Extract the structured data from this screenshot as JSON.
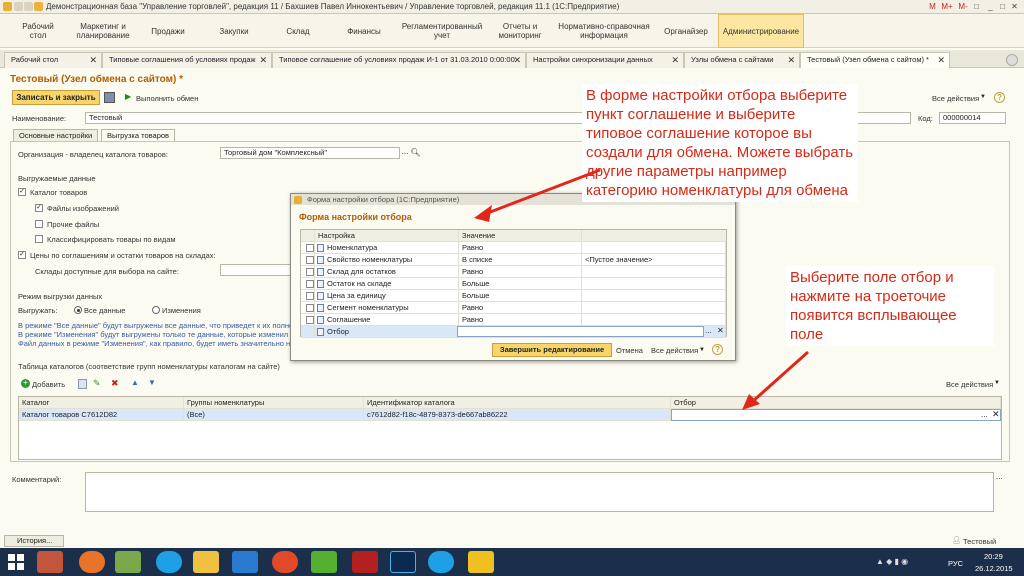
{
  "window": {
    "title": "Демонстрационная база \"Управление торговлей\", редакция 11 / Бахшиев Павел Иннокентьевич / Управление торговлей, редакция 11.1  (1С:Предприятие)",
    "controls": [
      "M",
      "M+",
      "M-",
      "□",
      "_",
      "□",
      "✕"
    ]
  },
  "menu": {
    "items": [
      {
        "label": "Рабочий\nстол"
      },
      {
        "label": "Маркетинг и\nпланирование"
      },
      {
        "label": "Продажи"
      },
      {
        "label": "Закупки"
      },
      {
        "label": "Склад"
      },
      {
        "label": "Финансы"
      },
      {
        "label": "Регламентированный\nучет"
      },
      {
        "label": "Отчеты и\nмониторинг"
      },
      {
        "label": "Нормативно-справочная\nинформация"
      },
      {
        "label": "Органайзер"
      },
      {
        "label": "Администрирование"
      }
    ]
  },
  "tabs": [
    {
      "label": "Рабочий стол"
    },
    {
      "label": "Типовые соглашения об условиях продаж"
    },
    {
      "label": "Типовое соглашение об условиях продаж И-1 от 31.03.2010 0:00:00"
    },
    {
      "label": "Настройки синхронизации данных"
    },
    {
      "label": "Узлы обмена с сайтами"
    },
    {
      "label": "Тестовый (Узел обмена с сайтом) *"
    }
  ],
  "form": {
    "title": "Тестовый (Узел обмена с сайтом) *",
    "save_close": "Записать и закрыть",
    "run_exchange": "Выполнить обмен",
    "all_actions": "Все действия",
    "name_label": "Наименование:",
    "name_value": "Тестовый",
    "code_label": "Код:",
    "code_value": "000000014",
    "tab_main": "Основные настройки",
    "tab_upload": "Выгрузка товаров",
    "org_label": "Организация - владелец каталога товаров:",
    "org_value": "Торговый дом \"Комплексный\"",
    "uploaded_data": "Выгружаемые данные",
    "cb_catalog": "Каталог товаров",
    "cb_images": "Файлы изображений",
    "cb_other": "Прочие файлы",
    "cb_classify": "Классифицировать товары по видам",
    "cb_prices": "Цены по соглашениям и остатки товаров на складах:",
    "warehouses_label": "Склады доступные для выбора на сайте:",
    "mode_label": "Режим выгрузки данных",
    "upload_label": "Выгружать:",
    "radio_all": "Все данные",
    "radio_changes": "Изменения",
    "info1": "В режиме \"Все данные\" будут выгружены все данные, что приведет к их полно",
    "info2": "В режиме \"Изменения\" будут выгружены только те данные, которые изменил",
    "info3": "Файл данных в режиме \"Изменения\", как правило, будет иметь значительно н",
    "catalogs_title": "Таблица каталогов (соответствие групп номенклатуры каталогам на сайте)",
    "add_label": "Добавить",
    "all_actions2": "Все действия",
    "columns": [
      "Каталог",
      "Группы номенклатуры",
      "Идентификатор каталога",
      "Отбор"
    ],
    "row": [
      "Каталог товаров C7612D82",
      "(Все)",
      "c7612d82-f18c-4879-8373-de667ab86222",
      ""
    ],
    "comment_label": "Комментарий:",
    "history": "История...",
    "status_user": "Тестовый"
  },
  "dialog": {
    "window_title": "Форма настройки отбора  (1С:Предприятие)",
    "title": "Форма настройки отбора",
    "col_setting": "Настройка",
    "col_value": "Значение",
    "rows": [
      {
        "name": "Номенклатура",
        "cond": "Равно",
        "value": ""
      },
      {
        "name": "Свойство номенклатуры",
        "cond": "В списке",
        "value": "<Пустое значение>"
      },
      {
        "name": "Склад для остатков",
        "cond": "Равно",
        "value": ""
      },
      {
        "name": "Остаток на складе",
        "cond": "Больше",
        "value": ""
      },
      {
        "name": "Цена за единицу",
        "cond": "Больше",
        "value": ""
      },
      {
        "name": "Сегмент номенклатуры",
        "cond": "Равно",
        "value": ""
      },
      {
        "name": "Соглашение",
        "cond": "Равно",
        "value": ""
      },
      {
        "name": "Отбор",
        "cond": "",
        "value": ""
      }
    ],
    "finish_btn": "Завершить редактирование",
    "cancel": "Отмена",
    "all_actions": "Все действия"
  },
  "annotations": {
    "note1": "В форме настройки отбора выберите пункт соглашение и выберите типовое соглашение которое вы создали для обмена. Можете выбрать другие параметры например категорию номенклатуры для обмена",
    "note2": "Выберите  поле отбор и нажмите  на троеточие появится всплывающее поле"
  },
  "taskbar": {
    "lang": "РУС",
    "time": "20:29",
    "date": "26.12.2015"
  },
  "colors": {
    "accent": "#f7c94a",
    "annotation": "#d52a16",
    "selection": "#d8e8f8"
  }
}
